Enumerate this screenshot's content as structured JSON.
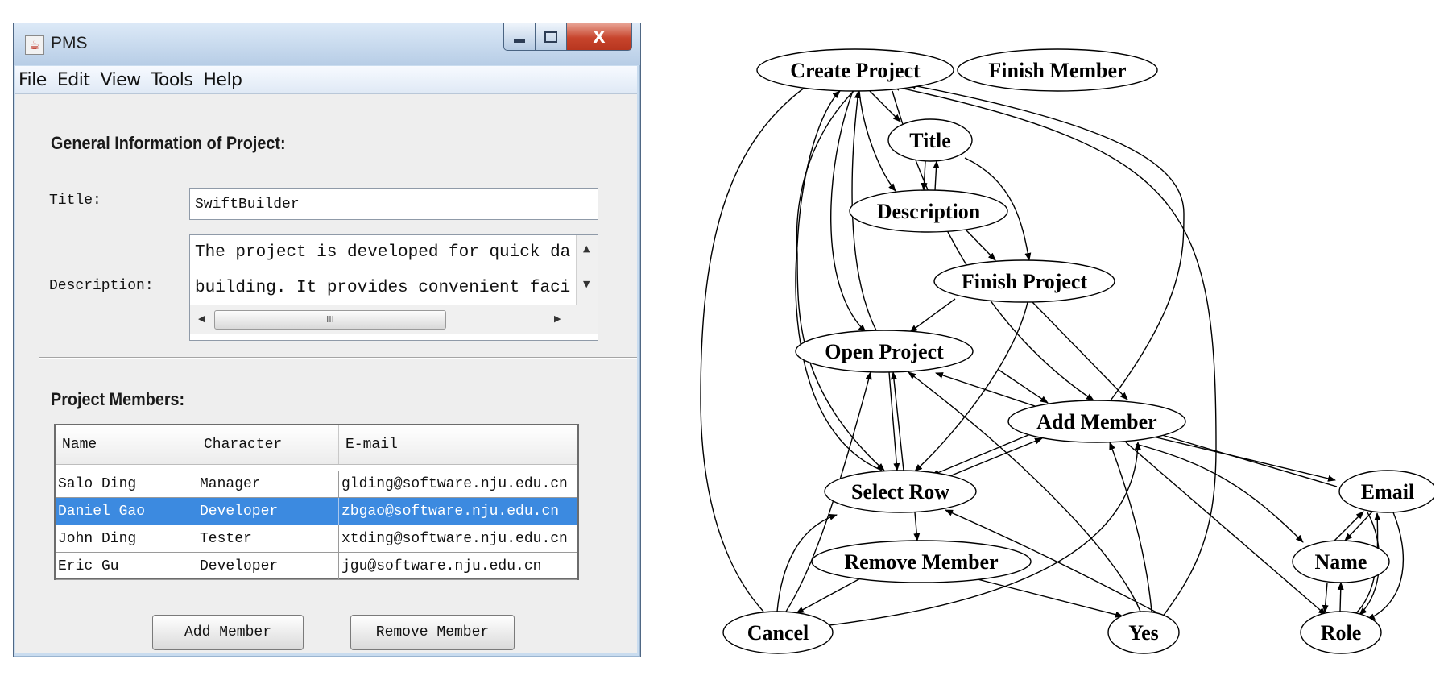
{
  "window": {
    "title": "PMS",
    "app_icon": "java-cup-icon",
    "controls": {
      "minimize": "minimize-icon",
      "maximize": "maximize-icon",
      "close": "X"
    }
  },
  "menu": [
    "File",
    "Edit",
    "View",
    "Tools",
    "Help"
  ],
  "general": {
    "heading": "General Information of Project:",
    "title_label": "Title:",
    "title_value": "SwiftBuilder",
    "description_label": "Description:",
    "description_lines": [
      "The project is developed for quick dat",
      "building. It provides convenient facil"
    ],
    "hscroll_grip": "III"
  },
  "members": {
    "heading": "Project Members:",
    "columns": [
      "Name",
      "Character",
      "E-mail"
    ],
    "rows": [
      [
        "Salo Ding",
        "Manager",
        "glding@software.nju.edu.cn"
      ],
      [
        "Daniel Gao",
        "Developer",
        "zbgao@software.nju.edu.cn"
      ],
      [
        "John Ding",
        "Tester",
        "xtding@software.nju.edu.cn"
      ],
      [
        "Eric Gu",
        "Developer",
        "jgu@software.nju.edu.cn"
      ]
    ],
    "selected_row_index": 1
  },
  "buttons": {
    "add": "Add Member",
    "remove": "Remove Member"
  },
  "graph": {
    "nodes": [
      "Create Project",
      "Finish Member",
      "Title",
      "Description",
      "Finish Project",
      "Open Project",
      "Add Member",
      "Select Row",
      "Email",
      "Remove Member",
      "Name",
      "Cancel",
      "Yes",
      "Role"
    ]
  },
  "colors": {
    "selection": "#3c8ae0",
    "close_button": "#c7442c",
    "window_frame": "#c9dcef"
  }
}
